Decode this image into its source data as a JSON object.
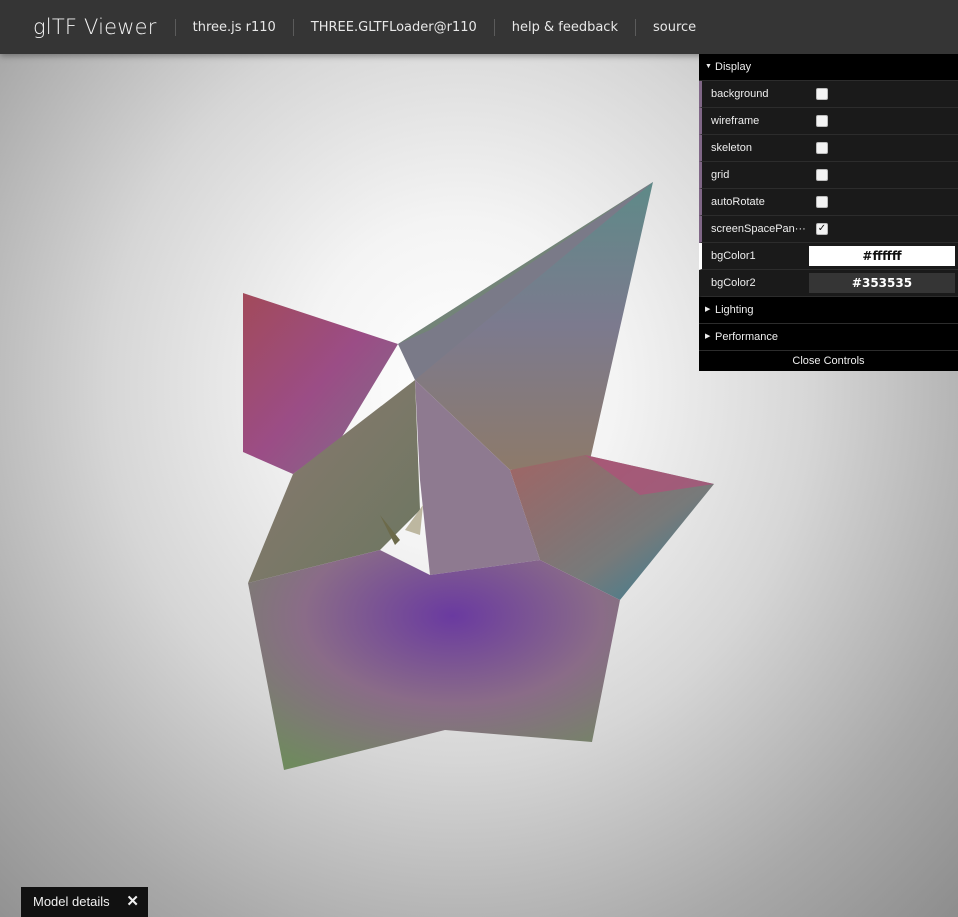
{
  "header": {
    "title": "glTF Viewer",
    "nav": [
      "three.js r110",
      "THREE.GLTFLoader@r110",
      "help & feedback",
      "source"
    ]
  },
  "gui": {
    "display_folder": "Display",
    "controls": [
      {
        "label": "background",
        "checked": false
      },
      {
        "label": "wireframe",
        "checked": false
      },
      {
        "label": "skeleton",
        "checked": false
      },
      {
        "label": "grid",
        "checked": false
      },
      {
        "label": "autoRotate",
        "checked": false
      },
      {
        "label": "screenSpacePan···",
        "checked": true
      }
    ],
    "bgColor1": {
      "label": "bgColor1",
      "value": "#ffffff"
    },
    "bgColor2": {
      "label": "bgColor2",
      "value": "#353535"
    },
    "lighting_folder": "Lighting",
    "performance_folder": "Performance",
    "close_label": "Close Controls",
    "check_glyph": "✓",
    "expanded_glyph": "▼",
    "collapsed_glyph": "▶"
  },
  "details": {
    "label": "Model details",
    "close_glyph": "✕"
  },
  "colors": {
    "header_bg": "#353535",
    "gui_bg": "#1a1a1a",
    "accent_bar": "#806787"
  }
}
